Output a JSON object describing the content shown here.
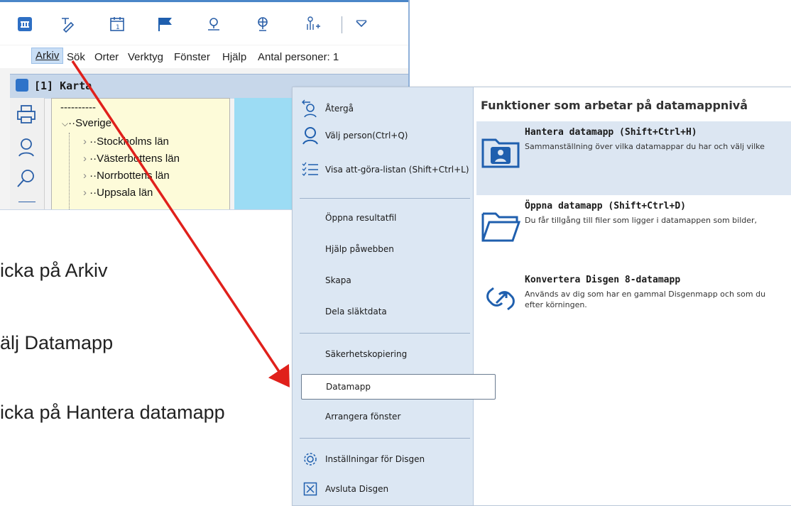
{
  "app": {
    "menubar": {
      "items": [
        "Arkiv",
        "Sök",
        "Orter",
        "Verktyg",
        "Fönster",
        "Hjälp"
      ],
      "status": "Antal personer: 1"
    },
    "window_title": "[1] Karta",
    "tree": {
      "dashes": "----------",
      "items": [
        "Sverige",
        "Stockholms län",
        "Västerbottens län",
        "Norrbottens län",
        "Uppsala län"
      ]
    }
  },
  "instructions": [
    "icka på Arkiv",
    "älj Datamapp",
    "icka på Hantera datamapp"
  ],
  "menu": {
    "left_items": [
      {
        "label": "Återgå",
        "icon": "back-person-icon"
      },
      {
        "label": "Välj person(Ctrl+Q)",
        "icon": "person-icon"
      },
      {
        "label": "Visa att-göra-listan (Shift+Ctrl+L)",
        "icon": "checklist-icon"
      },
      {
        "label": "Öppna resultatfil"
      },
      {
        "label": "Hjälp påwebben"
      },
      {
        "label": "Skapa"
      },
      {
        "label": "Dela släktdata"
      },
      {
        "label": "Säkerhetskopiering"
      },
      {
        "label": "Datamapp",
        "highlighted": true
      },
      {
        "label": "Arrangera fönster"
      },
      {
        "label": "Inställningar för Disgen",
        "icon": "gear-icon"
      },
      {
        "label": "Avsluta Disgen",
        "icon": "close-box-icon"
      }
    ],
    "right_title": "Funktioner som arbetar på datamappnivå",
    "right_blocks": [
      {
        "title": "Hantera datamapp (Shift+Ctrl+H)",
        "desc": "Sammanställning över vilka datamappar du har och välj vilke",
        "icon": "folder-person-icon",
        "selected": true
      },
      {
        "title": "Öppna datamapp  (Shift+Ctrl+D)",
        "desc": "Du får tillgång till filer som ligger i datamappen som bilder,",
        "icon": "folder-open-icon"
      },
      {
        "title": "Konvertera Disgen 8-datamapp",
        "desc": "Används av dig som har en gammal Disgenmapp och som du\nefter körningen.",
        "icon": "convert-link-icon"
      }
    ]
  },
  "colors": {
    "accent": "#1f5fae",
    "menu_left_bg": "#dce7f3",
    "selection_bg": "#dce6f2",
    "arrow": "#e0201b",
    "map_water": "#9cdcf4",
    "tree_bg": "#fdfbd9"
  }
}
